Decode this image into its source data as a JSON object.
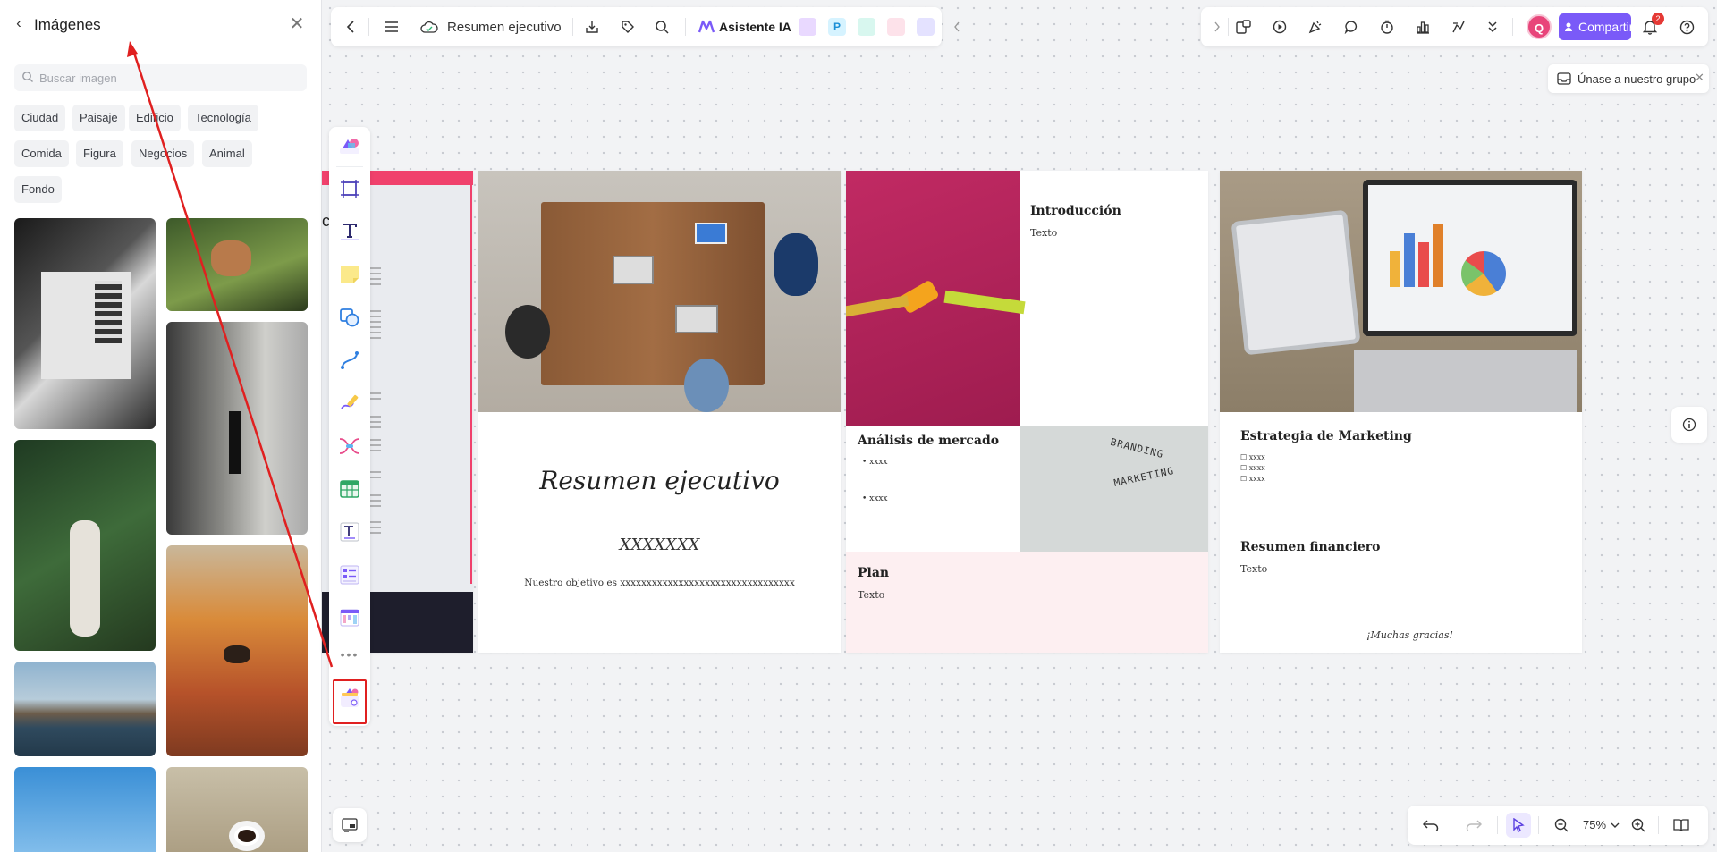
{
  "panel": {
    "title": "Imágenes",
    "search_placeholder": "Buscar imagen",
    "categories": [
      "Ciudad",
      "Paisaje",
      "Edificio",
      "Tecnología",
      "Comida",
      "Figura",
      "Negocios",
      "Animal",
      "Fondo"
    ]
  },
  "toolbar": {
    "doc_title": "Resumen ejecutivo",
    "ai_label": "Asistente IA",
    "share_label": "Compartir",
    "avatar_initial": "Q",
    "notification_count": "2"
  },
  "join_group": {
    "label": "Únase a nuestro grupo"
  },
  "slides": {
    "cover": {
      "title": "Resumen ejecutivo",
      "placeholder": "XXXXXXX",
      "objective": "Nuestro objetivo es xxxxxxxxxxxxxxxxxxxxxxxxxxxxxxxxx"
    },
    "partial": {
      "heading": "cutivo"
    },
    "market": {
      "intro_heading": "Introducción",
      "intro_text": "Texto",
      "analysis_heading": "Análisis de mercado",
      "bullets": [
        "xxxx",
        "xxxx"
      ],
      "branding_line1": "BRANDING",
      "branding_line2": "MARKETING",
      "plan_heading": "Plan",
      "plan_text": "Texto"
    },
    "finance": {
      "marketing_heading": "Estrategia de Marketing",
      "checklist": [
        "xxxx",
        "xxxx",
        "xxxx"
      ],
      "finance_heading": "Resumen financiero",
      "finance_text": "Texto",
      "thanks": "¡Muchas gracias!"
    }
  },
  "zoom": {
    "level": "75%"
  },
  "colors": {
    "accent": "#7a5af8",
    "highlight_red": "#e02020",
    "plan_bg": "#fdeff1",
    "magenta_bg": "#b5235b",
    "pink_bar": "#f0416c"
  }
}
